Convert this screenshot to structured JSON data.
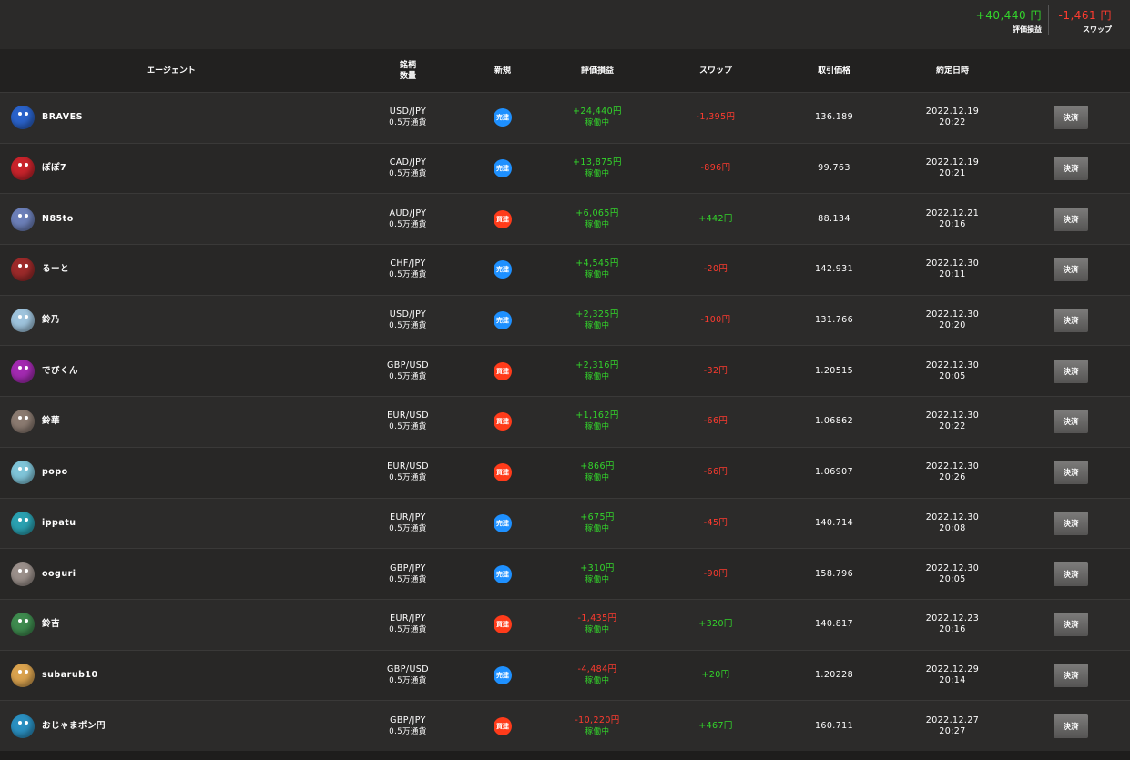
{
  "summary": {
    "pnl_value": "+40,440 円",
    "pnl_label": "評価損益",
    "swap_value": "-1,461 円",
    "swap_label": "スワップ"
  },
  "colors": {
    "positive": "#33d62b",
    "negative": "#ff3b2f",
    "sell_badge": "#1e90ff",
    "buy_badge": "#ff3b1a"
  },
  "headers": {
    "agent": "エージェント",
    "symbol": "銘柄",
    "quantity": "数量",
    "new": "新規",
    "pnl": "評価損益",
    "swap": "スワップ",
    "price": "取引価格",
    "date": "約定日時"
  },
  "rows": [
    {
      "agent": "BRAVES",
      "avatar_color": "#2a62c9",
      "pair": "USD/JPY",
      "qty": "0.5万通貨",
      "side": "売建",
      "side_type": "sell",
      "pnl": "+24,440円",
      "pnl_sign": "pos",
      "status": "稼働中",
      "swap": "-1,395円",
      "swap_sign": "neg",
      "price": "136.189",
      "date": "2022.12.19",
      "time": "20:22",
      "action": "決済"
    },
    {
      "agent": "ぽぽ7",
      "avatar_color": "#c8232b",
      "pair": "CAD/JPY",
      "qty": "0.5万通貨",
      "side": "売建",
      "side_type": "sell",
      "pnl": "+13,875円",
      "pnl_sign": "pos",
      "status": "稼働中",
      "swap": "-896円",
      "swap_sign": "neg",
      "price": "99.763",
      "date": "2022.12.19",
      "time": "20:21",
      "action": "決済"
    },
    {
      "agent": "N85to",
      "avatar_color": "#6c7fb8",
      "pair": "AUD/JPY",
      "qty": "0.5万通貨",
      "side": "買建",
      "side_type": "buy",
      "pnl": "+6,065円",
      "pnl_sign": "pos",
      "status": "稼働中",
      "swap": "+442円",
      "swap_sign": "pos",
      "price": "88.134",
      "date": "2022.12.21",
      "time": "20:16",
      "action": "決済"
    },
    {
      "agent": "るーと",
      "avatar_color": "#9c2a2a",
      "pair": "CHF/JPY",
      "qty": "0.5万通貨",
      "side": "売建",
      "side_type": "sell",
      "pnl": "+4,545円",
      "pnl_sign": "pos",
      "status": "稼働中",
      "swap": "-20円",
      "swap_sign": "neg",
      "price": "142.931",
      "date": "2022.12.30",
      "time": "20:11",
      "action": "決済"
    },
    {
      "agent": "鈴乃",
      "avatar_color": "#9ec3dc",
      "pair": "USD/JPY",
      "qty": "0.5万通貨",
      "side": "売建",
      "side_type": "sell",
      "pnl": "+2,325円",
      "pnl_sign": "pos",
      "status": "稼働中",
      "swap": "-100円",
      "swap_sign": "neg",
      "price": "131.766",
      "date": "2022.12.30",
      "time": "20:20",
      "action": "決済"
    },
    {
      "agent": "でびくん",
      "avatar_color": "#a22ab0",
      "pair": "GBP/USD",
      "qty": "0.5万通貨",
      "side": "買建",
      "side_type": "buy",
      "pnl": "+2,316円",
      "pnl_sign": "pos",
      "status": "稼働中",
      "swap": "-32円",
      "swap_sign": "neg",
      "price": "1.20515",
      "date": "2022.12.30",
      "time": "20:05",
      "action": "決済"
    },
    {
      "agent": "鈴華",
      "avatar_color": "#8a7a70",
      "pair": "EUR/USD",
      "qty": "0.5万通貨",
      "side": "買建",
      "side_type": "buy",
      "pnl": "+1,162円",
      "pnl_sign": "pos",
      "status": "稼働中",
      "swap": "-66円",
      "swap_sign": "neg",
      "price": "1.06862",
      "date": "2022.12.30",
      "time": "20:22",
      "action": "決済"
    },
    {
      "agent": "popo",
      "avatar_color": "#7fc4d8",
      "pair": "EUR/USD",
      "qty": "0.5万通貨",
      "side": "買建",
      "side_type": "buy",
      "pnl": "+866円",
      "pnl_sign": "pos",
      "status": "稼働中",
      "swap": "-66円",
      "swap_sign": "neg",
      "price": "1.06907",
      "date": "2022.12.30",
      "time": "20:26",
      "action": "決済"
    },
    {
      "agent": "ippatu",
      "avatar_color": "#2aa0b0",
      "pair": "EUR/JPY",
      "qty": "0.5万通貨",
      "side": "売建",
      "side_type": "sell",
      "pnl": "+675円",
      "pnl_sign": "pos",
      "status": "稼働中",
      "swap": "-45円",
      "swap_sign": "neg",
      "price": "140.714",
      "date": "2022.12.30",
      "time": "20:08",
      "action": "決済"
    },
    {
      "agent": "ooguri",
      "avatar_color": "#9a8f8a",
      "pair": "GBP/JPY",
      "qty": "0.5万通貨",
      "side": "売建",
      "side_type": "sell",
      "pnl": "+310円",
      "pnl_sign": "pos",
      "status": "稼働中",
      "swap": "-90円",
      "swap_sign": "neg",
      "price": "158.796",
      "date": "2022.12.30",
      "time": "20:05",
      "action": "決済"
    },
    {
      "agent": "鈴吉",
      "avatar_color": "#3e8a4e",
      "pair": "EUR/JPY",
      "qty": "0.5万通貨",
      "side": "買建",
      "side_type": "buy",
      "pnl": "-1,435円",
      "pnl_sign": "neg",
      "status": "稼働中",
      "swap": "+320円",
      "swap_sign": "pos",
      "price": "140.817",
      "date": "2022.12.23",
      "time": "20:16",
      "action": "決済"
    },
    {
      "agent": "subarub10",
      "avatar_color": "#d9a24e",
      "pair": "GBP/USD",
      "qty": "0.5万通貨",
      "side": "売建",
      "side_type": "sell",
      "pnl": "-4,484円",
      "pnl_sign": "neg",
      "status": "稼働中",
      "swap": "+20円",
      "swap_sign": "pos",
      "price": "1.20228",
      "date": "2022.12.29",
      "time": "20:14",
      "action": "決済"
    },
    {
      "agent": "おじゃまポン円",
      "avatar_color": "#2a8fc0",
      "pair": "GBP/JPY",
      "qty": "0.5万通貨",
      "side": "買建",
      "side_type": "buy",
      "pnl": "-10,220円",
      "pnl_sign": "neg",
      "status": "稼働中",
      "swap": "+467円",
      "swap_sign": "pos",
      "price": "160.711",
      "date": "2022.12.27",
      "time": "20:27",
      "action": "決済"
    }
  ]
}
